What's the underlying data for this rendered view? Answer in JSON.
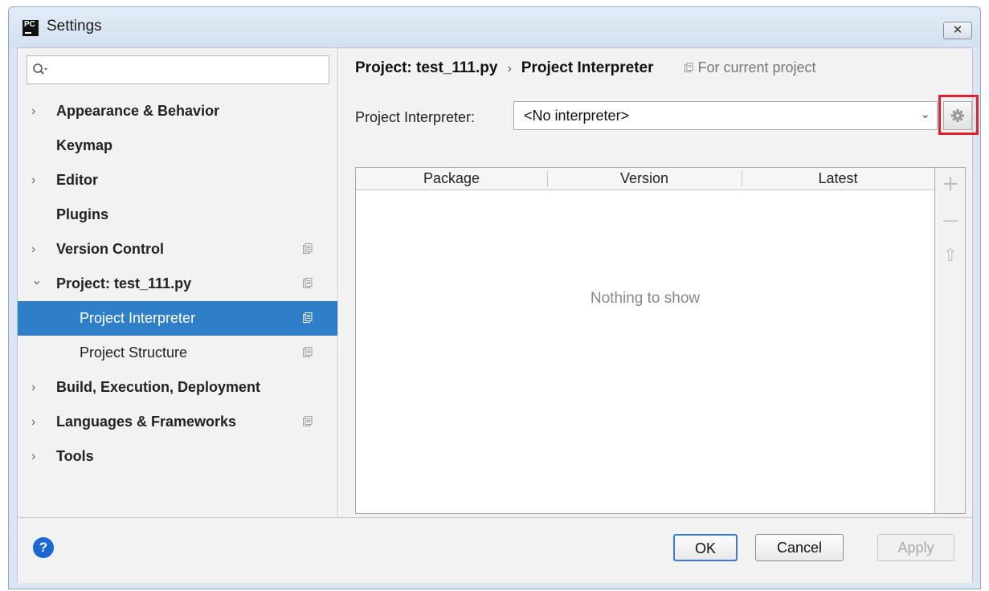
{
  "window": {
    "title": "Settings",
    "logo_text": "PC",
    "close_label": "✕"
  },
  "search": {
    "value": "",
    "placeholder": ""
  },
  "sidebar": {
    "items": [
      {
        "label": "Appearance & Behavior",
        "expander": "›",
        "bold": true
      },
      {
        "label": "Keymap",
        "expander": "",
        "bold": true
      },
      {
        "label": "Editor",
        "expander": "›",
        "bold": true
      },
      {
        "label": "Plugins",
        "expander": "",
        "bold": true
      },
      {
        "label": "Version Control",
        "expander": "›",
        "bold": true,
        "project_icon": true
      },
      {
        "label": "Project: test_111.py",
        "expander": "⌄",
        "bold": true,
        "project_icon": true
      },
      {
        "label": "Project Interpreter",
        "expander": "",
        "bold": false,
        "project_icon": true,
        "selected": true
      },
      {
        "label": "Project Structure",
        "expander": "",
        "bold": false,
        "project_icon": true
      },
      {
        "label": "Build, Execution, Deployment",
        "expander": "›",
        "bold": true
      },
      {
        "label": "Languages & Frameworks",
        "expander": "›",
        "bold": true,
        "project_icon": true
      },
      {
        "label": "Tools",
        "expander": "›",
        "bold": true
      }
    ]
  },
  "main": {
    "breadcrumb": {
      "project": "Project: test_111.py",
      "separator": "›",
      "page": "Project Interpreter",
      "scope_hint": "For current project"
    },
    "interpreter": {
      "label": "Project Interpreter:",
      "selected": "<No interpreter>"
    },
    "table": {
      "columns": [
        "Package",
        "Version",
        "Latest"
      ],
      "empty_text": "Nothing to show"
    },
    "tools": {
      "add": "+",
      "remove": "—",
      "upgrade": "⇧"
    }
  },
  "footer": {
    "help": "?",
    "ok": "OK",
    "cancel": "Cancel",
    "apply": "Apply"
  },
  "colors": {
    "selection": "#2f7fc8",
    "highlight": "#e0202b",
    "help": "#1a68d6"
  }
}
